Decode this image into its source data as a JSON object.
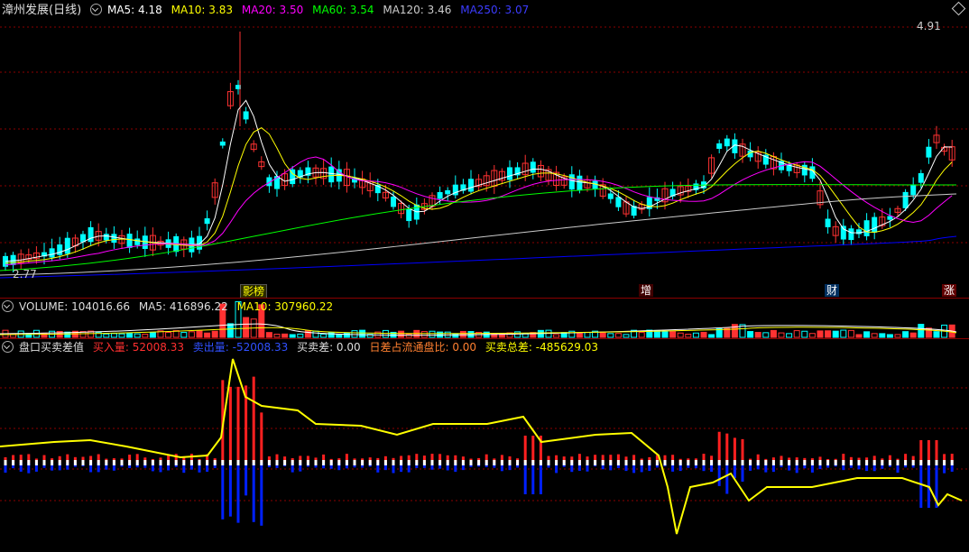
{
  "main_header": {
    "title": "漳州发展(日线)",
    "ma5": "MA5: 4.18",
    "ma10": "MA10: 3.83",
    "ma20": "MA20: 3.50",
    "ma60": "MA60: 3.54",
    "ma120": "MA120: 3.46",
    "ma250": "MA250: 3.07"
  },
  "price_labels": {
    "high": "4.91",
    "low": "2.77"
  },
  "event_tags": [
    {
      "label": "影榜",
      "color": "#ffff00"
    },
    {
      "label": "增",
      "color": "#ffffff"
    },
    {
      "label": "财",
      "color": "#ffffff"
    },
    {
      "label": "涨",
      "color": "#ffffff"
    }
  ],
  "volume_header": {
    "name": "VOLUME: 104016.66",
    "ma5": "MA5: 416896.22",
    "ma10": "MA10: 307960.22"
  },
  "indicator_header": {
    "name": "盘口买卖差值",
    "buy": "买入量: 52008.33",
    "sell": "卖出量: -52008.33",
    "diff": "买卖差: 0.00",
    "ratio": "日差占流通盘比: 0.00",
    "total": "买卖总差: -485629.03"
  },
  "colors": {
    "up": "#ff3232",
    "down": "#00ffff",
    "ma5": "#ffffff",
    "ma10": "#ffff00",
    "ma20": "#ff00ff",
    "ma60": "#00ff00",
    "ma120": "#cccccc",
    "ma250": "#0000ff",
    "grid": "#8b0000",
    "buy_bar": "#ff2020",
    "sell_bar": "#0020ff",
    "diff_line": "#ffff00"
  }
}
